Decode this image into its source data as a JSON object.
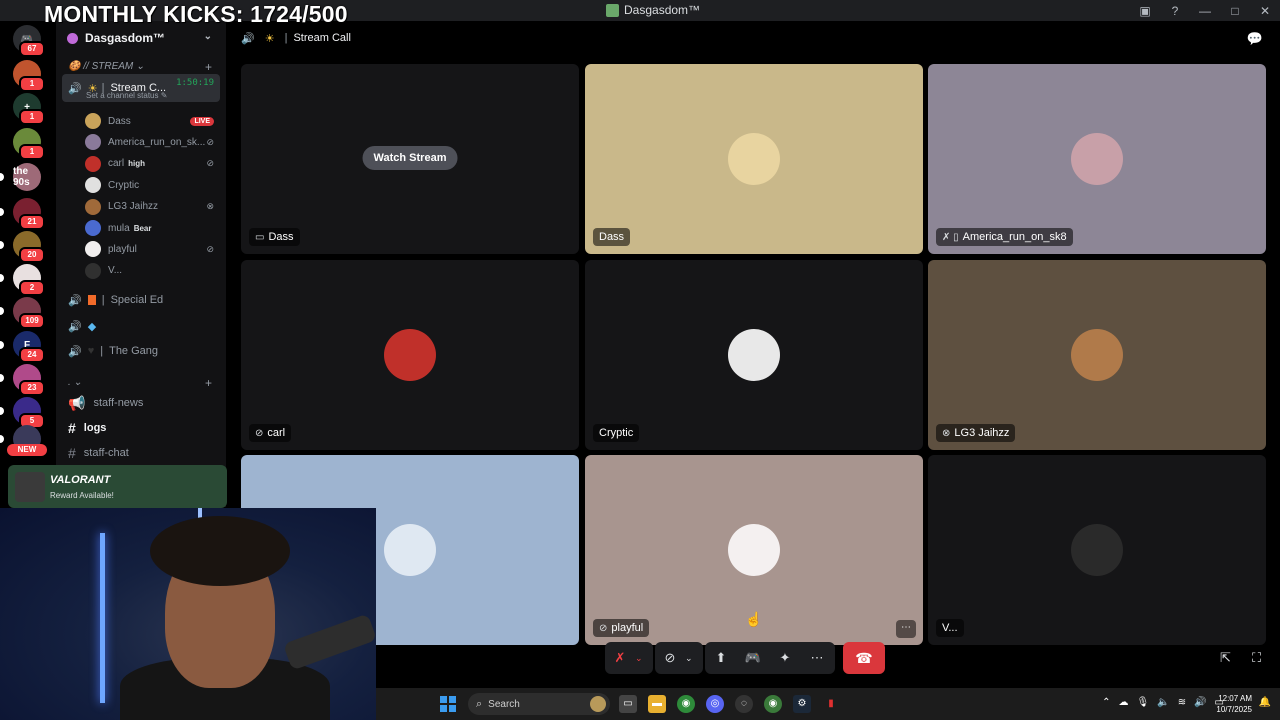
{
  "overlay": {
    "kicks_text": "MONTHLY KICKS: 1724/500"
  },
  "window": {
    "title": "Dasgasdom™"
  },
  "titlebar_icons": [
    "inbox-icon",
    "help-icon",
    "minimize-icon",
    "maximize-icon",
    "close-icon"
  ],
  "rail": {
    "home_badge": "67",
    "servers": [
      {
        "label": "",
        "badge": "1",
        "color": "#c0542e"
      },
      {
        "label": "+",
        "badge": "1",
        "color": "#1e3b2f"
      },
      {
        "label": "",
        "badge": "1",
        "color": "#6a8a3a"
      },
      {
        "label": "the 90s",
        "badge": "",
        "color": "#9e6a78"
      },
      {
        "label": "",
        "badge": "21",
        "color": "#7a2030"
      },
      {
        "label": "",
        "badge": "20",
        "color": "#8a6a2a"
      },
      {
        "label": "",
        "badge": "2",
        "color": "#e8e0e0"
      },
      {
        "label": "",
        "badge": "109",
        "color": "#7a3a4a"
      },
      {
        "label": "F",
        "badge": "24",
        "color": "#1a2a6a"
      },
      {
        "label": "",
        "badge": "23",
        "color": "#b04a8a"
      },
      {
        "label": "",
        "badge": "5",
        "color": "#3a2a8a"
      },
      {
        "label": "",
        "badge": "",
        "color": "#3a3a5a"
      }
    ],
    "new_label": "NEW"
  },
  "sidebar": {
    "guild_name": "Dasgasdom™",
    "category_stream": "// STREAM",
    "active_channel": {
      "name": "Stream C...",
      "timer": "1:50:19",
      "status": "Set a channel status"
    },
    "members": [
      {
        "name": "Dass",
        "tag": "",
        "live": "LIVE",
        "color": "#c9a35a"
      },
      {
        "name": "America_run_on_sk...",
        "tag": "",
        "live": "",
        "color": "#8a7a9a"
      },
      {
        "name": "carl",
        "tag": "high",
        "live": "",
        "color": "#c0302a"
      },
      {
        "name": "Cryptic",
        "tag": "",
        "live": "",
        "color": "#e0e0e0"
      },
      {
        "name": "LG3 Jaihzz",
        "tag": "",
        "live": "",
        "color": "#a06a3a"
      },
      {
        "name": "mula",
        "tag": "Bear",
        "live": "",
        "color": "#4a6ad0"
      },
      {
        "name": "playful",
        "tag": "",
        "live": "",
        "color": "#f0eeee"
      },
      {
        "name": "V...",
        "tag": "",
        "live": "",
        "color": "#303030"
      }
    ],
    "voice_channels": [
      "Special Ed",
      "",
      "The Gang"
    ],
    "category_two": ".",
    "text_channels": [
      "staff-news",
      "logs",
      "staff-chat"
    ],
    "promo": {
      "title": "VALORANT",
      "subtitle": "Reward Available!"
    }
  },
  "main": {
    "header_title": "Stream Call",
    "watch_stream": "Watch Stream",
    "tiles": [
      {
        "name": "Dass",
        "bg": "#151517",
        "avatar": "",
        "icon": "screen-share-icon"
      },
      {
        "name": "Dass",
        "bg": "#c9b88a",
        "avatar": "#e8d4a0",
        "icon": ""
      },
      {
        "name": "America_run_on_sk8",
        "bg": "#8d8696",
        "avatar": "#c8a0a8",
        "icon": "muted-mobile-icon"
      },
      {
        "name": "carl",
        "bg": "#151517",
        "avatar": "#c0302a",
        "icon": "deafened-icon"
      },
      {
        "name": "Cryptic",
        "bg": "#151517",
        "avatar": "#e8e8e8",
        "icon": ""
      },
      {
        "name": "LG3 Jaihzz",
        "bg": "#5e5040",
        "avatar": "#b07a4a",
        "icon": "xbox-icon"
      },
      {
        "name": "",
        "bg": "#9eb4d0",
        "avatar": "#dfe8f2",
        "icon": ""
      },
      {
        "name": "playful",
        "bg": "#a8958f",
        "avatar": "#f4f0f0",
        "icon": "deafened-icon"
      },
      {
        "name": "V...",
        "bg": "#151517",
        "avatar": "#2a2a2a",
        "icon": ""
      }
    ]
  },
  "taskbar": {
    "search_placeholder": "Search",
    "clock_time": "12:07 AM",
    "clock_date": "10/7/2025"
  }
}
